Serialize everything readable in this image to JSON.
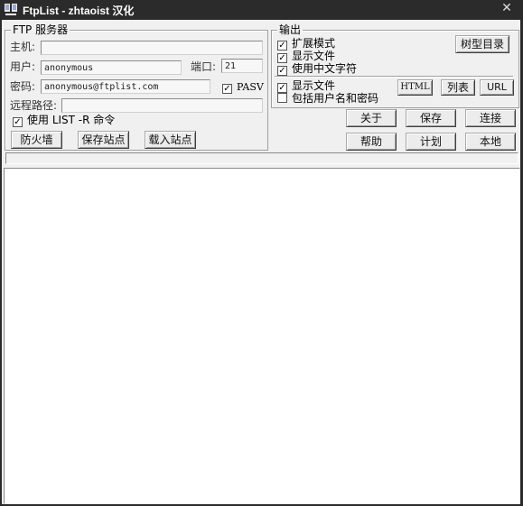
{
  "window": {
    "title": "FtpList - zhtaoist 汉化",
    "close_glyph": "✕"
  },
  "server": {
    "legend": "FTP 服务器",
    "host_label": "主机:",
    "host_value": "",
    "user_label": "用户:",
    "user_value": "anonymous",
    "port_label": "端口:",
    "port_value": "21",
    "password_label": "密码:",
    "password_value": "anonymous@ftplist.com",
    "pasv_label": "PASV",
    "pasv_checked": true,
    "remote_path_label": "远程路径:",
    "remote_path_value": "",
    "list_r_label": "使用 LIST -R 命令",
    "list_r_checked": true,
    "firewall_button": "防火墙",
    "save_site_button": "保存站点",
    "load_site_button": "载入站点"
  },
  "output": {
    "legend": "输出",
    "extended_mode_label": "扩展模式",
    "extended_mode_checked": true,
    "show_files_label": "显示文件",
    "show_files_checked": true,
    "use_chinese_label": "使用中文字符",
    "use_chinese_checked": true,
    "tree_dir_button": "树型目录",
    "show_files2_label": "显示文件",
    "show_files2_checked": true,
    "include_credentials_label": "包括用户名和密码",
    "include_credentials_checked": false,
    "html_button": "HTML",
    "list_button": "列表",
    "url_button": "URL"
  },
  "actions": {
    "about": "关于",
    "save": "保存",
    "connect": "连接",
    "help": "帮助",
    "schedule": "计划",
    "local": "本地"
  },
  "icons": {
    "app": "ftplist-app-icon",
    "close": "close-icon",
    "check": "checkmark-icon"
  },
  "colors": {
    "titlebar_bg": "#2b2b2b",
    "client_bg": "#f0f0f0",
    "output_bg": "#ffffff"
  }
}
